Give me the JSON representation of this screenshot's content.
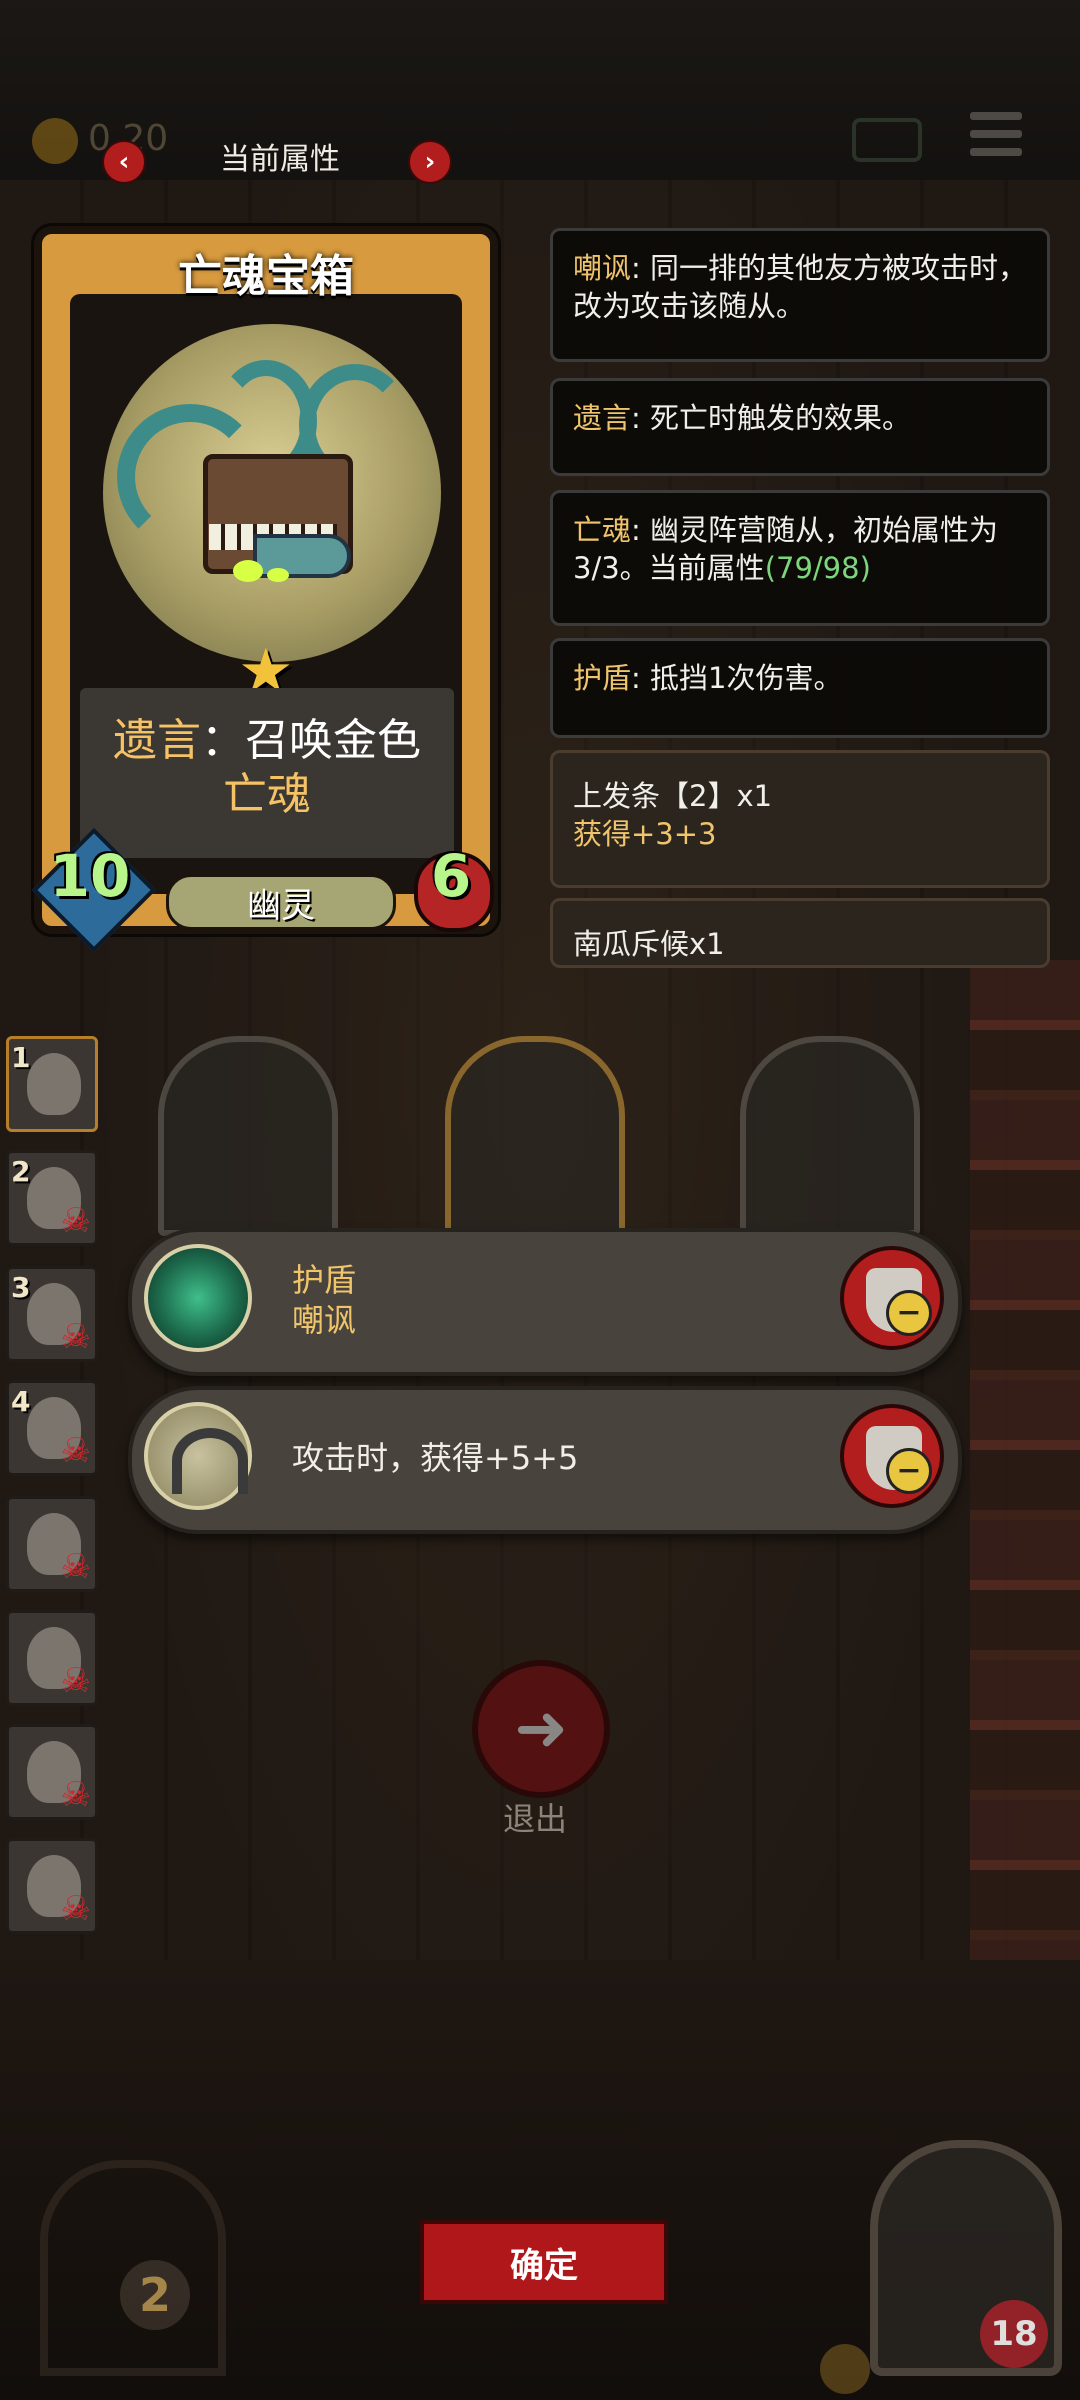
{
  "top_bar": {
    "coin_text": "0 20"
  },
  "header": {
    "title": "当前属性",
    "prev_label": "‹",
    "next_label": "›"
  },
  "card": {
    "name": "亡魂宝箱",
    "desc_prefix": "遗言",
    "desc_colon": "：",
    "desc_main": "召唤金色",
    "desc_gold": "亡魂",
    "attack": "10",
    "health": "6",
    "tribe": "幽灵"
  },
  "keywords": [
    {
      "name": "嘲讽",
      "text": ": 同一排的其他友方被攻击时，改为攻击该随从。"
    },
    {
      "name": "遗言",
      "text": ": 死亡时触发的效果。"
    },
    {
      "name": "亡魂",
      "text": ": 幽灵阵营随从，初始属性为3/3。当前属性",
      "extra": "(79/98)"
    },
    {
      "name": "护盾",
      "text": ": 抵挡1次伤害。"
    }
  ],
  "bonuses": [
    {
      "title": "上发条【2】x1",
      "effect": "获得+3+3"
    },
    {
      "title": "南瓜斥候x1"
    }
  ],
  "units": [
    "1",
    "2",
    "3",
    "4",
    "",
    "",
    "",
    ""
  ],
  "enhancements": [
    {
      "line1": "护盾",
      "line2": "嘲讽"
    },
    {
      "line1": "攻击时，获得+5+5"
    }
  ],
  "exit_label": "退出",
  "confirm_label": "确定",
  "cage_number": "2",
  "hero_hp": "18",
  "colors": {
    "accent_red": "#b0171a",
    "gold_text": "#efc46b",
    "green_text": "#7cd77c"
  }
}
